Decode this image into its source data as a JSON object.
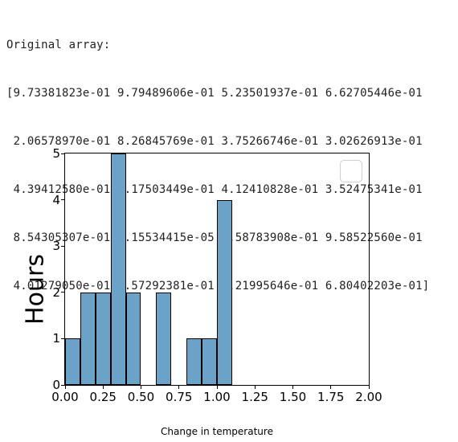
{
  "text_block": {
    "title": "Original array:",
    "rows": [
      "[9.73381823e-01 9.79489606e-01 5.23501937e-01 6.62705446e-01",
      " 2.06578970e-01 8.26845769e-01 3.75266746e-01 3.02626913e-01",
      " 4.39412580e-01 2.17503449e-01 4.12410828e-01 3.52475341e-01",
      " 8.54305307e-01 3.15534415e-05 3.58783908e-01 9.58522560e-01",
      " 4.01279050e-01 9.57292381e-01 1.21995646e-01 6.80402203e-01]"
    ]
  },
  "chart_data": {
    "type": "bar",
    "title": "",
    "xlabel": "Change in temperature",
    "ylabel": "Hours",
    "xlim": [
      0.0,
      2.0
    ],
    "ylim": [
      0,
      5
    ],
    "bin_width": 0.1,
    "bin_edges": [
      0.0,
      0.1,
      0.2,
      0.3,
      0.4,
      0.5,
      0.6,
      0.7,
      0.8,
      0.9,
      1.0,
      1.1,
      1.2,
      1.3,
      1.4,
      1.5,
      1.6,
      1.7,
      1.8,
      1.9,
      2.0
    ],
    "counts": [
      1,
      2,
      2,
      5,
      2,
      0,
      2,
      0,
      1,
      1,
      4,
      0,
      0,
      0,
      0,
      0,
      0,
      0,
      0,
      0
    ],
    "x_ticks": [
      "0.00",
      "0.25",
      "0.50",
      "0.75",
      "1.00",
      "1.25",
      "1.50",
      "1.75",
      "2.00"
    ],
    "x_tick_positions": [
      0.0,
      0.25,
      0.5,
      0.75,
      1.0,
      1.25,
      1.5,
      1.75,
      2.0
    ],
    "y_ticks": [
      "0",
      "1",
      "2",
      "3",
      "4",
      "5"
    ],
    "y_tick_positions": [
      0,
      1,
      2,
      3,
      4,
      5
    ],
    "bar_color": "#6aa2c8",
    "legend_empty": true
  }
}
